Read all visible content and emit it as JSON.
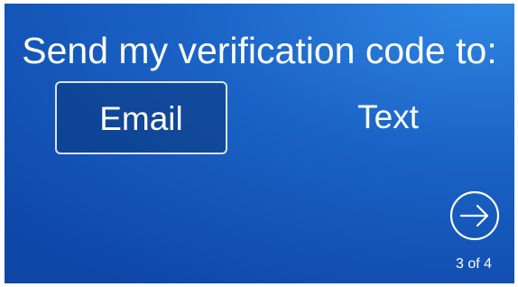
{
  "screen": {
    "heading": "Send my verification code to:",
    "options": [
      {
        "label": "Email",
        "selected": true
      },
      {
        "label": "Text",
        "selected": false
      }
    ],
    "next_icon": "arrow-right-circle-icon",
    "pager": "3 of 4"
  },
  "colors": {
    "background_top": "#2f86e3",
    "background_bottom": "#0d47a8",
    "text": "#ffffff"
  }
}
